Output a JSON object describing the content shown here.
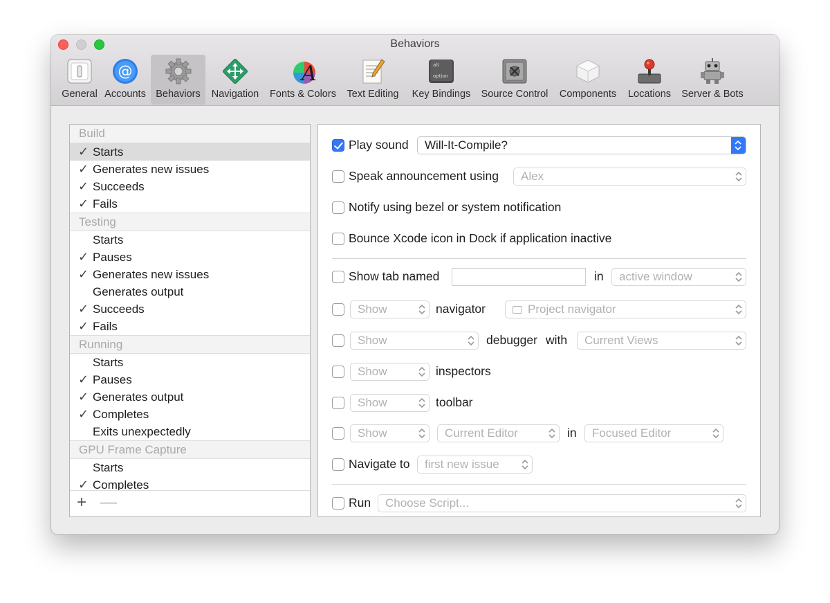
{
  "window": {
    "title": "Behaviors"
  },
  "toolbar": {
    "items": [
      {
        "label": "General",
        "icon": "general-switch-icon"
      },
      {
        "label": "Accounts",
        "icon": "at-sign-icon"
      },
      {
        "label": "Behaviors",
        "icon": "gear-icon",
        "selected": true
      },
      {
        "label": "Navigation",
        "icon": "move-arrows-icon"
      },
      {
        "label": "Fonts & Colors",
        "icon": "font-color-wheel-icon"
      },
      {
        "label": "Text Editing",
        "icon": "notepad-pencil-icon"
      },
      {
        "label": "Key Bindings",
        "icon": "keyboard-key-icon"
      },
      {
        "label": "Source Control",
        "icon": "safe-icon"
      },
      {
        "label": "Components",
        "icon": "component-box-icon"
      },
      {
        "label": "Locations",
        "icon": "joystick-icon"
      },
      {
        "label": "Server & Bots",
        "icon": "robot-icon"
      }
    ],
    "key_labels": {
      "top": "alt",
      "bottom": "option"
    }
  },
  "events": {
    "groups": [
      {
        "header": "Build",
        "items": [
          {
            "label": "Starts",
            "checked": true,
            "selected": true
          },
          {
            "label": "Generates new issues",
            "checked": true
          },
          {
            "label": "Succeeds",
            "checked": true
          },
          {
            "label": "Fails",
            "checked": true
          }
        ]
      },
      {
        "header": "Testing",
        "items": [
          {
            "label": "Starts",
            "checked": false
          },
          {
            "label": "Pauses",
            "checked": true
          },
          {
            "label": "Generates new issues",
            "checked": true
          },
          {
            "label": "Generates output",
            "checked": false
          },
          {
            "label": "Succeeds",
            "checked": true
          },
          {
            "label": "Fails",
            "checked": true
          }
        ]
      },
      {
        "header": "Running",
        "items": [
          {
            "label": "Starts",
            "checked": false
          },
          {
            "label": "Pauses",
            "checked": true
          },
          {
            "label": "Generates output",
            "checked": true
          },
          {
            "label": "Completes",
            "checked": true
          },
          {
            "label": "Exits unexpectedly",
            "checked": false
          }
        ]
      },
      {
        "header": "GPU Frame Capture",
        "items": [
          {
            "label": "Starts",
            "checked": false
          },
          {
            "label": "Completes",
            "checked": true
          }
        ]
      }
    ],
    "check_glyph": "✓",
    "add_label": "+",
    "remove_label": "—"
  },
  "actions": {
    "play_sound": {
      "label": "Play sound",
      "checked": true,
      "value": "Will-It-Compile?"
    },
    "speak": {
      "label": "Speak announcement using",
      "checked": false,
      "value": "Alex"
    },
    "notify": {
      "label": "Notify using bezel or system notification",
      "checked": false
    },
    "bounce": {
      "label": "Bounce Xcode icon in Dock if application inactive",
      "checked": false
    },
    "show_tab": {
      "label": "Show tab named",
      "checked": false,
      "value": "",
      "in_label": "in",
      "window": "active window"
    },
    "navigator": {
      "checked": false,
      "mode": "Show",
      "label": "navigator",
      "value": "Project navigator"
    },
    "debugger": {
      "checked": false,
      "mode": "Show",
      "label": "debugger",
      "with_label": "with",
      "value": "Current Views"
    },
    "inspectors": {
      "checked": false,
      "mode": "Show",
      "label": "inspectors"
    },
    "toolbar": {
      "checked": false,
      "mode": "Show",
      "label": "toolbar"
    },
    "editor": {
      "checked": false,
      "mode": "Show",
      "value": "Current Editor",
      "in_label": "in",
      "target": "Focused Editor"
    },
    "navigate": {
      "label": "Navigate to",
      "checked": false,
      "value": "first new issue"
    },
    "run": {
      "label": "Run",
      "checked": false,
      "value": "Choose Script..."
    }
  },
  "colors": {
    "accent": "#3478f6",
    "placeholder": "#b1b1b1",
    "group_header": "#a9a9a9"
  }
}
